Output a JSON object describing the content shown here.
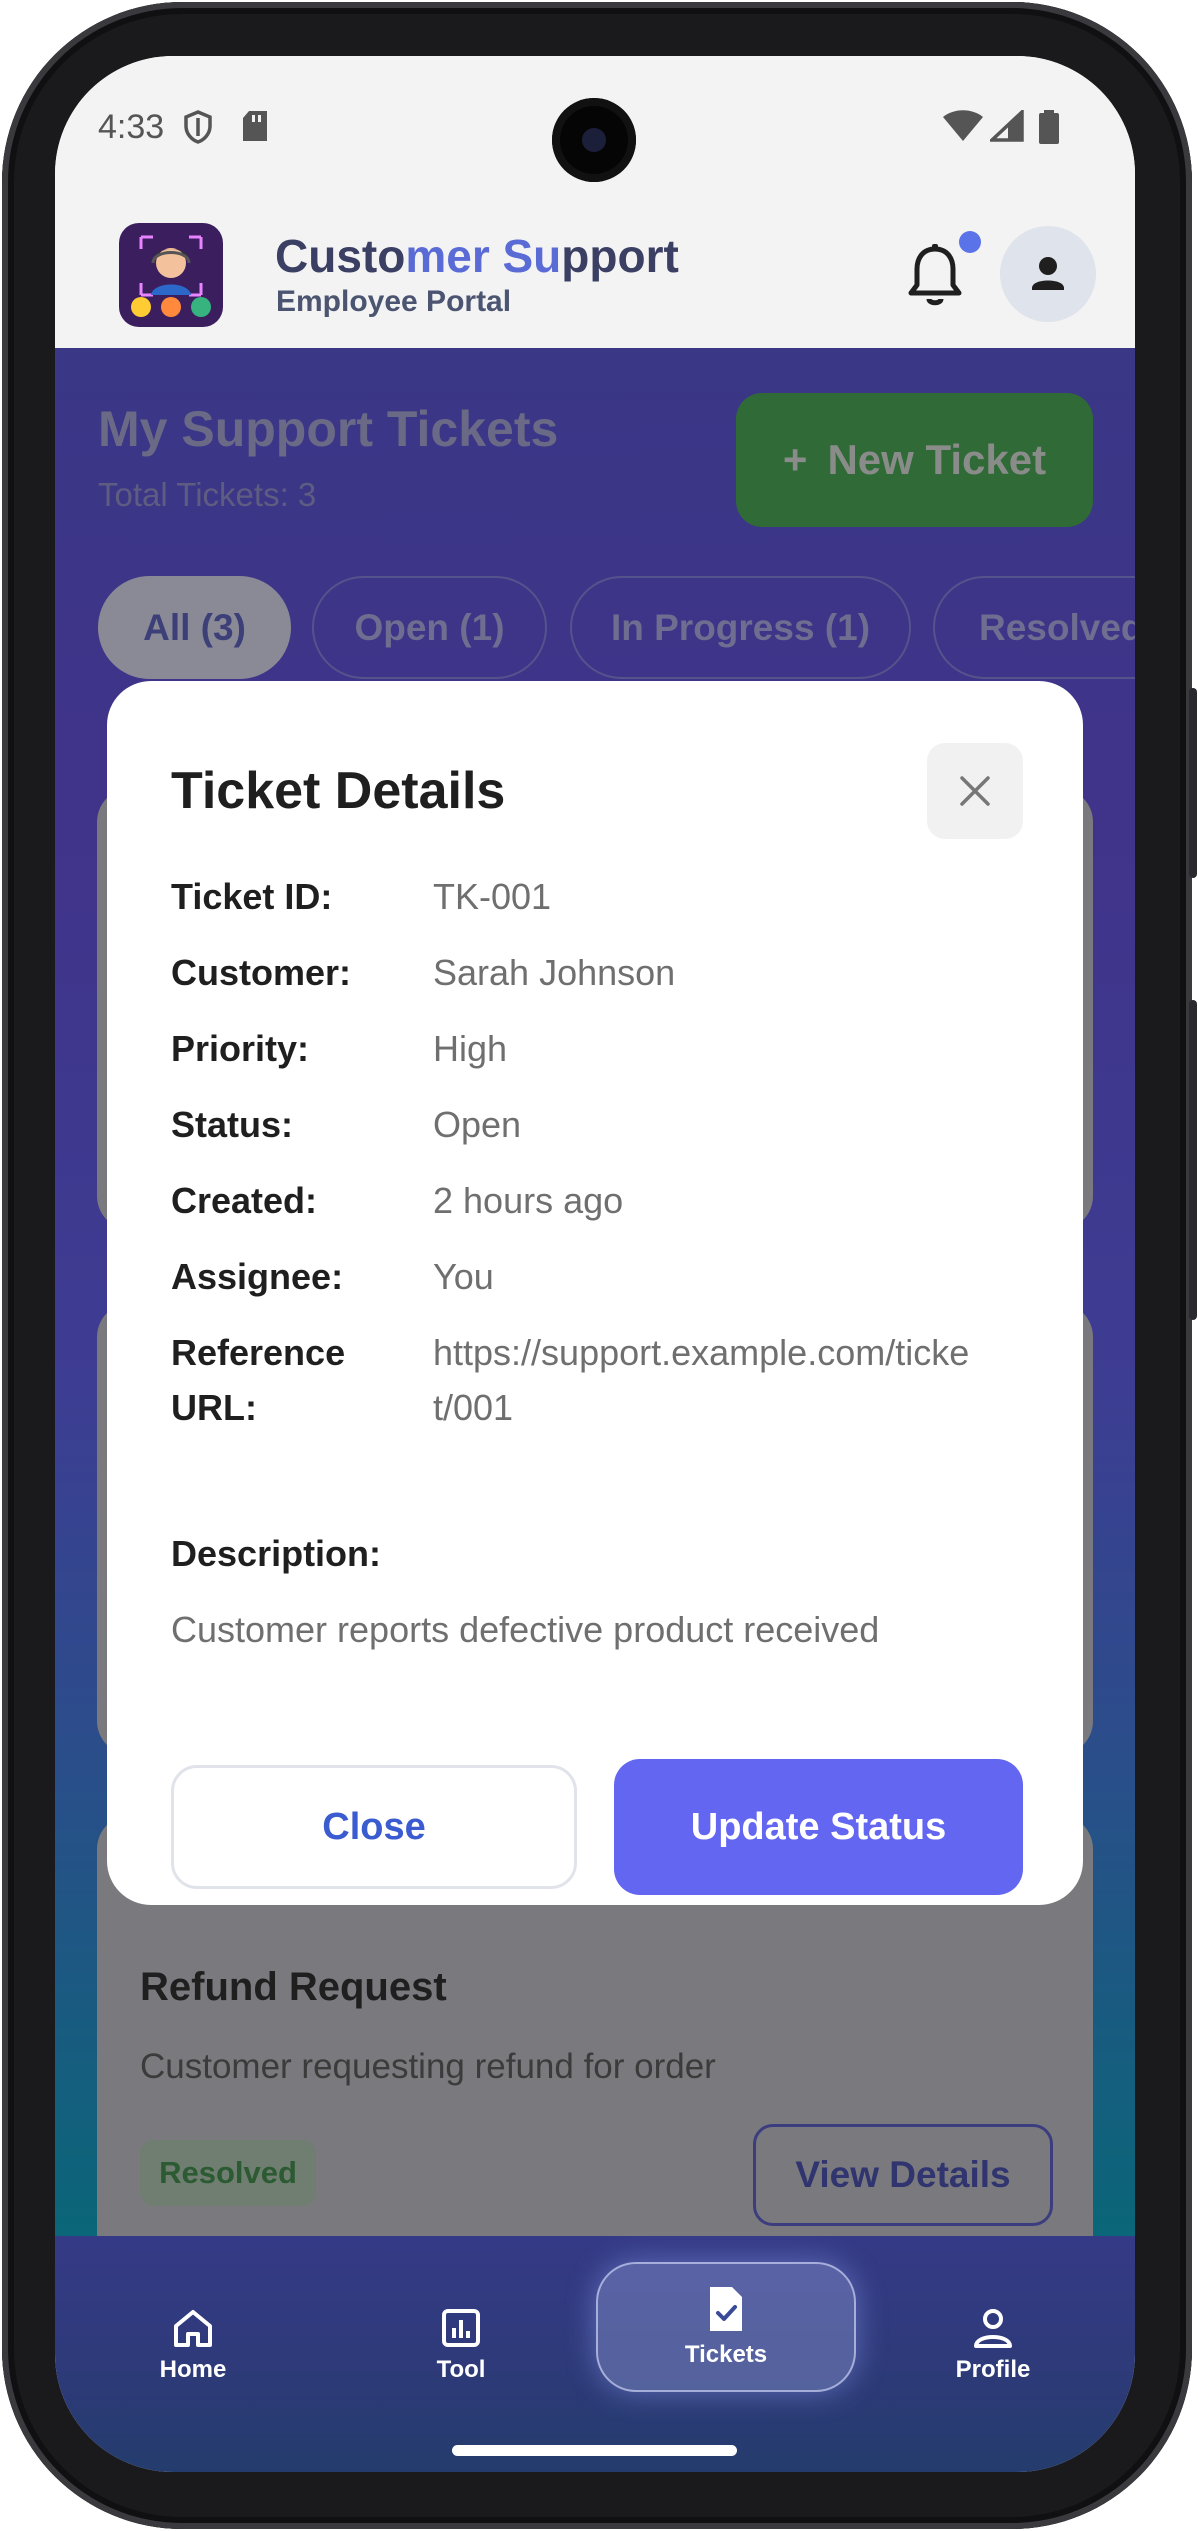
{
  "status_bar": {
    "time": "4:33"
  },
  "app": {
    "title_part1": "Custo",
    "title_part2": "mer Su",
    "title_part3": "pport",
    "subtitle": "Employee Portal"
  },
  "page": {
    "heading": "My Support Tickets",
    "total": "Total Tickets: 3",
    "new_ticket_label": "New Ticket",
    "filters": [
      "All (3)",
      "Open (1)",
      "In Progress (1)",
      "Resolved"
    ]
  },
  "visible_card": {
    "title": "Refund Request",
    "description": "Customer requesting refund for order",
    "badge": "Resolved",
    "action": "View Details"
  },
  "modal": {
    "title": "Ticket Details",
    "rows": [
      {
        "label": "Ticket ID:",
        "value": "TK-001"
      },
      {
        "label": "Customer:",
        "value": "Sarah Johnson"
      },
      {
        "label": "Priority:",
        "value": "High"
      },
      {
        "label": "Status:",
        "value": "Open"
      },
      {
        "label": "Created:",
        "value": "2 hours ago"
      },
      {
        "label": "Assignee:",
        "value": "You"
      },
      {
        "label": "Reference URL:",
        "value": "https://support.example.com/ticket/001"
      }
    ],
    "description_heading": "Description:",
    "description": "Customer reports defective product received",
    "close_label": "Close",
    "update_label": "Update Status"
  },
  "nav": {
    "items": [
      {
        "label": "Home",
        "icon": "home-icon"
      },
      {
        "label": "Tool",
        "icon": "chart-icon"
      },
      {
        "label": "Tickets",
        "icon": "ticket-check-icon"
      },
      {
        "label": "Profile",
        "icon": "person-icon"
      }
    ],
    "active": "Tickets"
  },
  "colors": {
    "accent": "#6366f1",
    "new_ticket_green": "#2f6a37",
    "title_accent": "#5b6bd6",
    "notification_dot": "#5b73e8"
  }
}
